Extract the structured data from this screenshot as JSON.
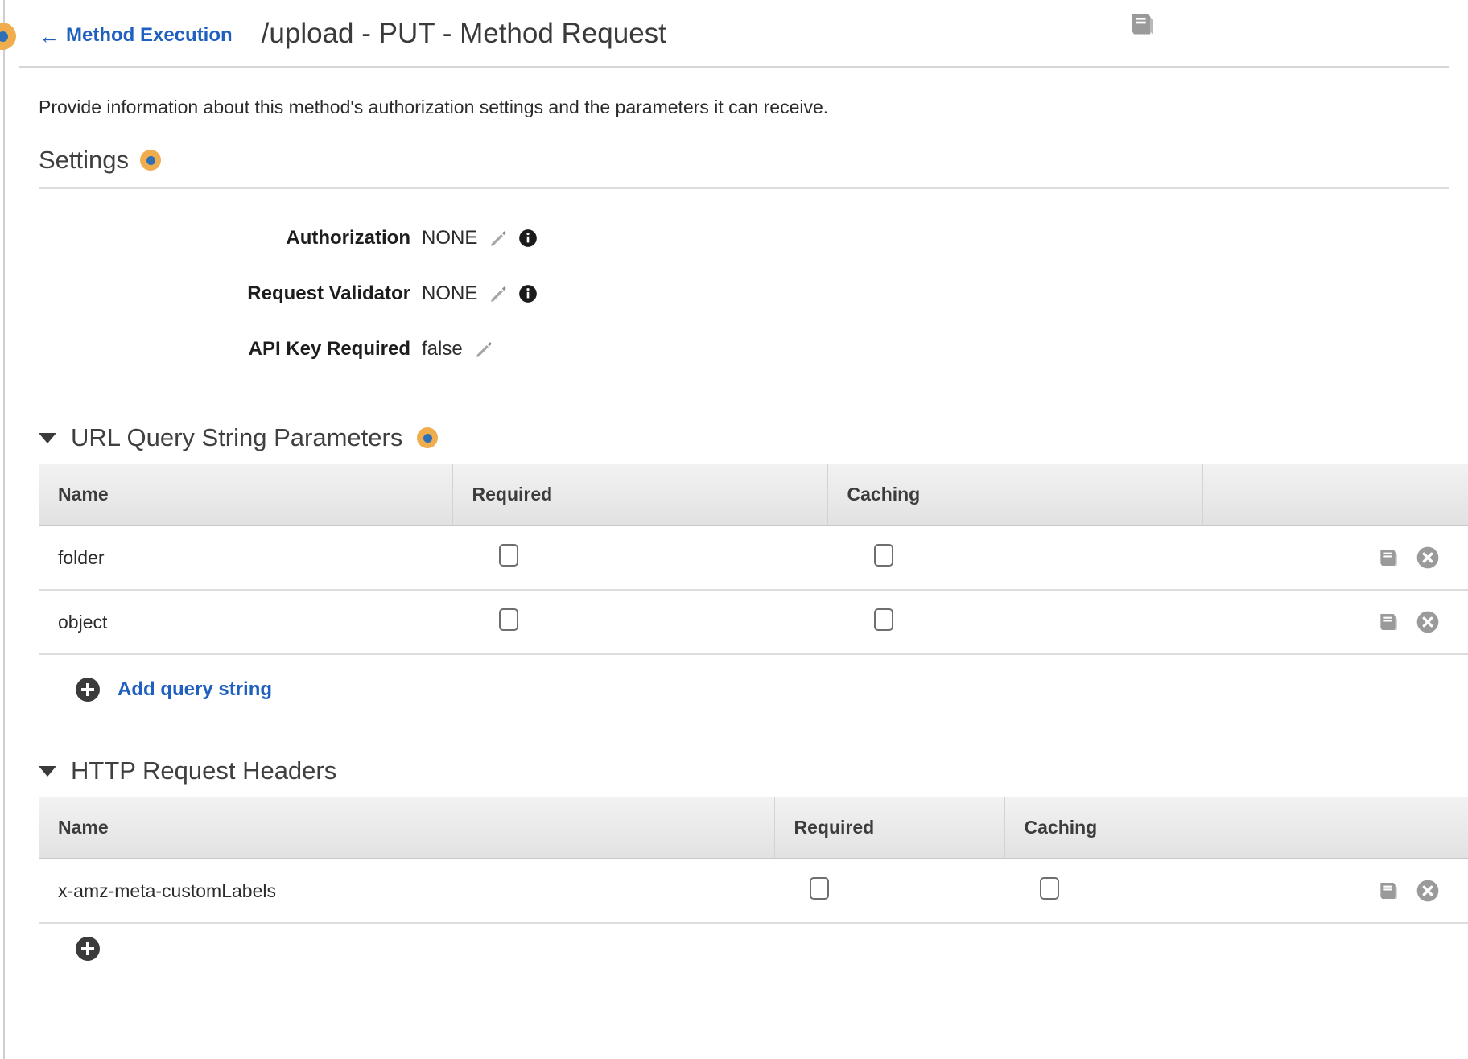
{
  "header": {
    "back_label": "Method Execution",
    "back_arrow": "left-arrow-icon",
    "title": "/upload - PUT - Method Request",
    "doc_icon": "book-icon"
  },
  "description": "Provide information about this method's authorization settings and the parameters it can receive.",
  "settings": {
    "heading": "Settings",
    "info_icon": "info-dot-icon",
    "rows": [
      {
        "label": "Authorization",
        "value": "NONE",
        "edit_icon": "pencil-icon",
        "info_icon": "info-circle-icon"
      },
      {
        "label": "Request Validator",
        "value": "NONE",
        "edit_icon": "pencil-icon",
        "info_icon": "info-circle-icon"
      },
      {
        "label": "API Key Required",
        "value": "false",
        "edit_icon": "pencil-icon",
        "info_icon": ""
      }
    ]
  },
  "query_params": {
    "heading": "URL Query String Parameters",
    "info_icon": "info-dot-icon",
    "caret": "caret-down-icon",
    "columns": [
      "Name",
      "Required",
      "Caching",
      ""
    ],
    "rows": [
      {
        "name": "folder",
        "required": false,
        "caching": false,
        "doc_icon": "book-icon",
        "delete_icon": "circle-x-icon"
      },
      {
        "name": "object",
        "required": false,
        "caching": false,
        "doc_icon": "book-icon",
        "delete_icon": "circle-x-icon"
      }
    ],
    "add_label": "Add query string",
    "add_icon": "plus-circle-icon"
  },
  "request_headers": {
    "heading": "HTTP Request Headers",
    "caret": "caret-down-icon",
    "columns": [
      "Name",
      "Required",
      "Caching",
      ""
    ],
    "rows": [
      {
        "name": "x-amz-meta-customLabels",
        "required": false,
        "caching": false,
        "doc_icon": "book-icon",
        "delete_icon": "circle-x-icon"
      }
    ]
  },
  "colors": {
    "link": "#1f5fbf",
    "accent_orange": "#f0ad4e",
    "accent_blue": "#2f6fb5",
    "icon_gray": "#9a9a9a",
    "text": "#2b2b2b"
  }
}
